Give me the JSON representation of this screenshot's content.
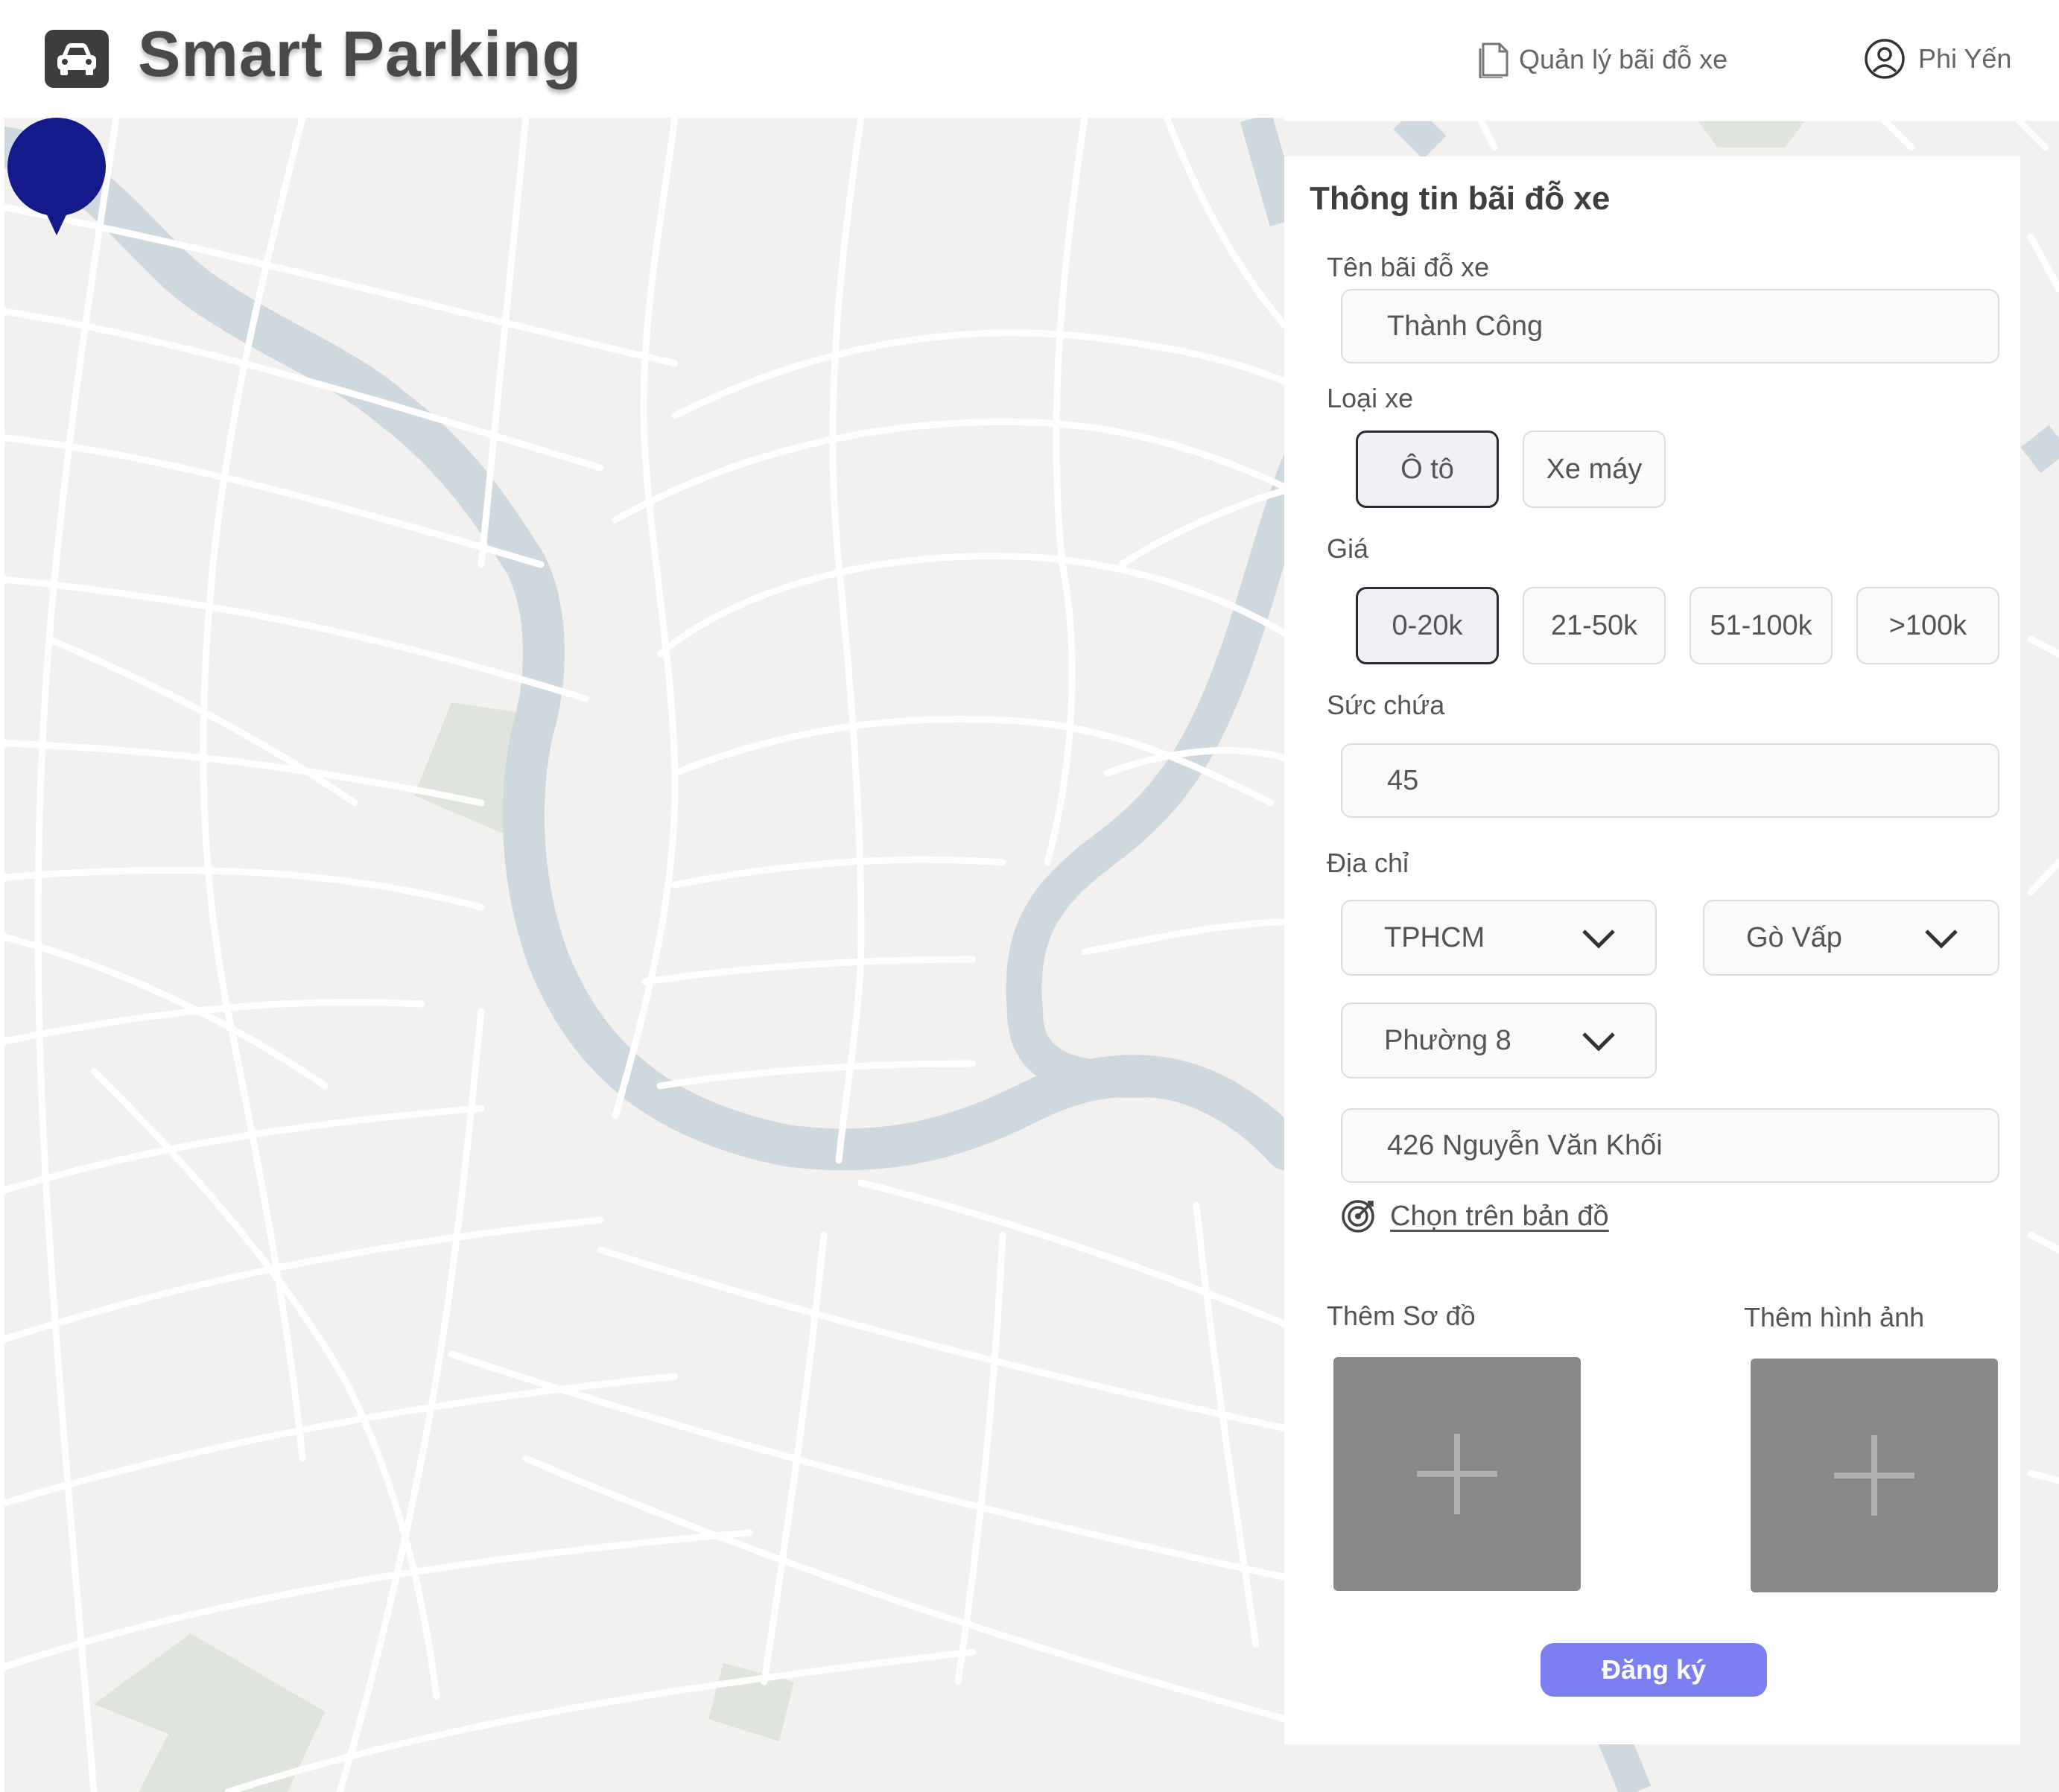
{
  "app": {
    "title": "Smart Parking",
    "logo_icon": "car-icon"
  },
  "nav": {
    "manage_label": "Quản lý bãi đỗ xe",
    "manage_icon": "document-icon",
    "user_name": "Phi Yến",
    "user_icon": "user-avatar-icon"
  },
  "map": {
    "marker_icon": "map-pin-icon",
    "marker_color": "#141a8a"
  },
  "form": {
    "title": "Thông tin bãi đỗ xe",
    "name": {
      "label": "Tên bãi đỗ xe",
      "value": "Thành Công"
    },
    "vehicle": {
      "label": "Loại xe",
      "options": [
        "Ô tô",
        "Xe máy"
      ],
      "selected": "Ô tô"
    },
    "price": {
      "label": "Giá",
      "options": [
        "0-20k",
        "21-50k",
        "51-100k",
        ">100k"
      ],
      "selected": "0-20k"
    },
    "capacity": {
      "label": "Sức chứa",
      "value": "45"
    },
    "address": {
      "label": "Địa chỉ",
      "city": "TPHCM",
      "district": "Gò Vấp",
      "ward": "Phường 8",
      "street": "426 Nguyễn Văn Khối",
      "pick_on_map": "Chọn trên bản đồ",
      "pick_icon": "target-icon"
    },
    "add_diagram": "Thêm Sơ đồ",
    "add_image": "Thêm hình ảnh",
    "submit": "Đăng ký"
  },
  "colors": {
    "accent": "#7b7ff0",
    "marker": "#141a8a",
    "map_background": "#f2f1ef",
    "river": "#cdd9df",
    "park": "#dfe5dc",
    "road": "#ffffff"
  }
}
